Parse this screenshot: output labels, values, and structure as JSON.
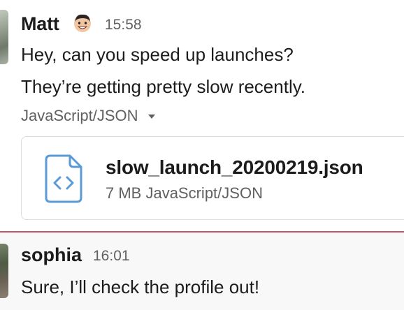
{
  "messages": [
    {
      "sender": "Matt",
      "time": "15:58",
      "status_emoji": "grinning-face-emoji",
      "lines": [
        "Hey, can you speed up launches?",
        "They’re getting pretty slow recently."
      ],
      "attachment_toggle": "JavaScript/JSON",
      "attachment": {
        "icon": "code-file-icon",
        "file_name": "slow_launch_20200219.json",
        "meta": "7 MB JavaScript/JSON"
      }
    },
    {
      "sender": "sophia",
      "time": "16:01",
      "lines": [
        "Sure, I’ll check the profile out!"
      ]
    }
  ],
  "colors": {
    "new_message_divider": "#c5506b",
    "file_icon": "#5a9bd5",
    "secondary_text": "#616061",
    "highlight_background": "#f8f8f8"
  }
}
